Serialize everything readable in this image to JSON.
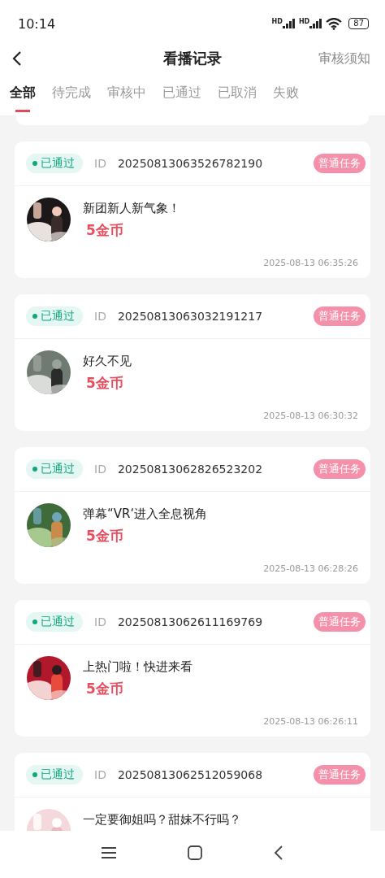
{
  "status_bar": {
    "time": "10:14",
    "signal_labels": [
      "HD",
      "HD"
    ],
    "battery": "87"
  },
  "nav": {
    "title": "看播记录",
    "action": "审核须知"
  },
  "tabs": [
    {
      "label": "全部",
      "selected": true
    },
    {
      "label": "待完成",
      "selected": false
    },
    {
      "label": "审核中",
      "selected": false
    },
    {
      "label": "已通过",
      "selected": false
    },
    {
      "label": "已取消",
      "selected": false
    },
    {
      "label": "失败",
      "selected": false
    }
  ],
  "records": [
    {
      "status": "已通过",
      "id_label": "ID",
      "id": "20250813063526782190",
      "tag": "普通任务",
      "title": "新团新人新气象！",
      "reward": "5金币",
      "time": "2025-08-13 06:35:26"
    },
    {
      "status": "已通过",
      "id_label": "ID",
      "id": "20250813063032191217",
      "tag": "普通任务",
      "title": "好久不见",
      "reward": "5金币",
      "time": "2025-08-13 06:30:32"
    },
    {
      "status": "已通过",
      "id_label": "ID",
      "id": "20250813062826523202",
      "tag": "普通任务",
      "title": "弹幕“VR‘进入全息视角",
      "reward": "5金币",
      "time": "2025-08-13 06:28:26"
    },
    {
      "status": "已通过",
      "id_label": "ID",
      "id": "20250813062611169769",
      "tag": "普通任务",
      "title": "上热门啦！快进来看",
      "reward": "5金币",
      "time": "2025-08-13 06:26:11"
    },
    {
      "status": "已通过",
      "id_label": "ID",
      "id": "20250813062512059068",
      "tag": "普通任务",
      "title": "一定要御姐吗？甜妹不行吗？"
    }
  ]
}
